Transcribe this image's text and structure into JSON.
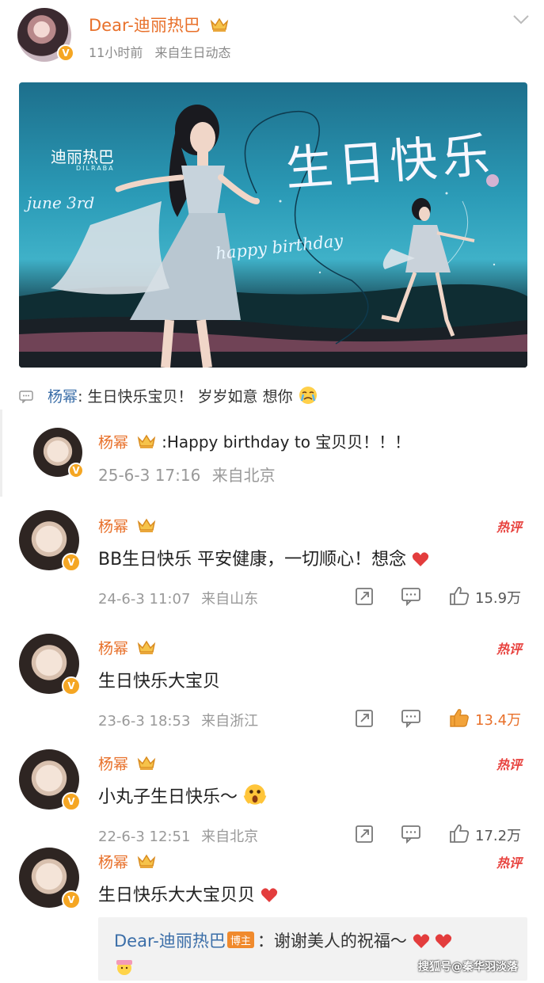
{
  "post": {
    "author": "Dear-迪丽热巴",
    "time": "11小时前",
    "source": "来自生日动态",
    "verified_badge": "V"
  },
  "banner": {
    "logo": "迪丽热巴",
    "logo_sub": "DILRABA",
    "june": "june 3rd",
    "title": "生日快乐",
    "happy": "happy birthday"
  },
  "top_comment": {
    "name": "杨幂",
    "text": ": 生日快乐宝贝！ 岁岁如意 想你"
  },
  "comments": [
    {
      "name": "杨幂",
      "text": ":Happy birthday to 宝贝贝！！！",
      "date": "25-6-3 17:16",
      "source": "来自北京"
    },
    {
      "name": "杨幂",
      "hot": "热评",
      "text": "BB生日快乐 平安健康，一切顺心！想念",
      "date": "24-6-3 11:07",
      "source": "来自山东",
      "likes": "15.9万"
    },
    {
      "name": "杨幂",
      "hot": "热评",
      "text": "生日快乐大宝贝",
      "date": "23-6-3 18:53",
      "source": "来自浙江",
      "likes": "13.4万"
    },
    {
      "name": "杨幂",
      "hot": "热评",
      "text": "小丸子生日快乐～",
      "date": "22-6-3 12:51",
      "source": "来自北京",
      "likes": "17.2万"
    },
    {
      "name": "杨幂",
      "hot": "热评",
      "text": "生日快乐大大宝贝贝"
    }
  ],
  "reply": {
    "name": "Dear-迪丽热巴",
    "tag": "博主",
    "text": "：谢谢美人的祝福～"
  },
  "watermark": "搜狐号@秦华羽淡落",
  "colors": {
    "name_orange": "#e8702a",
    "link_blue": "#3b6ea8",
    "hot_red": "#e8433f",
    "like_active": "#f2a33a"
  },
  "icons": [
    "chevron-down-icon",
    "crown-icon",
    "comment-icon",
    "share-icon",
    "reply-icon",
    "like-icon",
    "heart-icon"
  ]
}
